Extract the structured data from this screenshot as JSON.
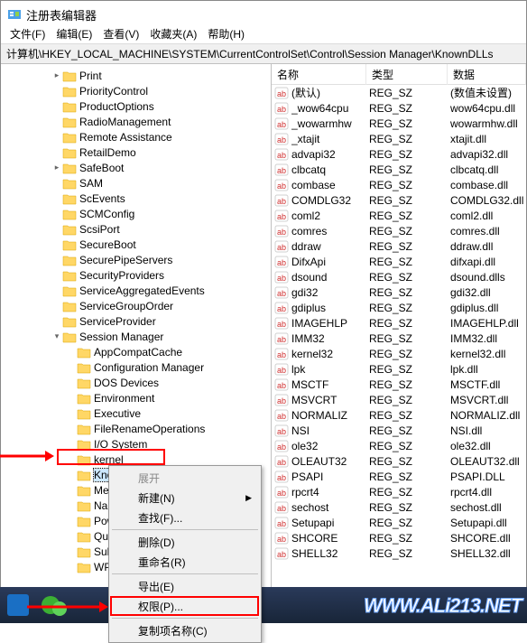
{
  "window": {
    "title": "注册表编辑器"
  },
  "menu": {
    "file": "文件(F)",
    "edit": "编辑(E)",
    "view": "查看(V)",
    "favorites": "收藏夹(A)",
    "help": "帮助(H)"
  },
  "address": {
    "path": "计算机\\HKEY_LOCAL_MACHINE\\SYSTEM\\CurrentControlSet\\Control\\Session Manager\\KnownDLLs"
  },
  "list_headers": {
    "name": "名称",
    "type": "类型",
    "data": "数据"
  },
  "tree": [
    {
      "indent": 3,
      "exp": ">",
      "label": "Print"
    },
    {
      "indent": 3,
      "exp": "",
      "label": "PriorityControl"
    },
    {
      "indent": 3,
      "exp": "",
      "label": "ProductOptions"
    },
    {
      "indent": 3,
      "exp": "",
      "label": "RadioManagement"
    },
    {
      "indent": 3,
      "exp": "",
      "label": "Remote Assistance"
    },
    {
      "indent": 3,
      "exp": "",
      "label": "RetailDemo"
    },
    {
      "indent": 3,
      "exp": ">",
      "label": "SafeBoot"
    },
    {
      "indent": 3,
      "exp": "",
      "label": "SAM"
    },
    {
      "indent": 3,
      "exp": "",
      "label": "ScEvents"
    },
    {
      "indent": 3,
      "exp": "",
      "label": "SCMConfig"
    },
    {
      "indent": 3,
      "exp": "",
      "label": "ScsiPort"
    },
    {
      "indent": 3,
      "exp": "",
      "label": "SecureBoot"
    },
    {
      "indent": 3,
      "exp": "",
      "label": "SecurePipeServers"
    },
    {
      "indent": 3,
      "exp": "",
      "label": "SecurityProviders"
    },
    {
      "indent": 3,
      "exp": "",
      "label": "ServiceAggregatedEvents"
    },
    {
      "indent": 3,
      "exp": "",
      "label": "ServiceGroupOrder"
    },
    {
      "indent": 3,
      "exp": "",
      "label": "ServiceProvider"
    },
    {
      "indent": 3,
      "exp": "v",
      "label": "Session Manager"
    },
    {
      "indent": 4,
      "exp": "",
      "label": "AppCompatCache"
    },
    {
      "indent": 4,
      "exp": "",
      "label": "Configuration Manager"
    },
    {
      "indent": 4,
      "exp": "",
      "label": "DOS Devices"
    },
    {
      "indent": 4,
      "exp": "",
      "label": "Environment"
    },
    {
      "indent": 4,
      "exp": "",
      "label": "Executive"
    },
    {
      "indent": 4,
      "exp": "",
      "label": "FileRenameOperations"
    },
    {
      "indent": 4,
      "exp": "",
      "label": "I/O System"
    },
    {
      "indent": 4,
      "exp": "",
      "label": "kernel"
    },
    {
      "indent": 4,
      "exp": "",
      "label": "KnownDLLs",
      "hl": true
    },
    {
      "indent": 4,
      "exp": "",
      "label": "Mem"
    },
    {
      "indent": 4,
      "exp": "",
      "label": "Nam"
    },
    {
      "indent": 4,
      "exp": "",
      "label": "Pow"
    },
    {
      "indent": 4,
      "exp": "",
      "label": "Quot"
    },
    {
      "indent": 4,
      "exp": "",
      "label": "SubS"
    },
    {
      "indent": 4,
      "exp": "",
      "label": "WPA"
    }
  ],
  "values": [
    {
      "name": "(默认)",
      "type": "REG_SZ",
      "data": "(数值未设置)"
    },
    {
      "name": "_wow64cpu",
      "type": "REG_SZ",
      "data": "wow64cpu.dll"
    },
    {
      "name": "_wowarmhw",
      "type": "REG_SZ",
      "data": "wowarmhw.dll"
    },
    {
      "name": "_xtajit",
      "type": "REG_SZ",
      "data": "xtajit.dll"
    },
    {
      "name": "advapi32",
      "type": "REG_SZ",
      "data": "advapi32.dll"
    },
    {
      "name": "clbcatq",
      "type": "REG_SZ",
      "data": "clbcatq.dll"
    },
    {
      "name": "combase",
      "type": "REG_SZ",
      "data": "combase.dll"
    },
    {
      "name": "COMDLG32",
      "type": "REG_SZ",
      "data": "COMDLG32.dll"
    },
    {
      "name": "coml2",
      "type": "REG_SZ",
      "data": "coml2.dll"
    },
    {
      "name": "comres",
      "type": "REG_SZ",
      "data": "comres.dll"
    },
    {
      "name": "ddraw",
      "type": "REG_SZ",
      "data": "ddraw.dll"
    },
    {
      "name": "DifxApi",
      "type": "REG_SZ",
      "data": "difxapi.dll"
    },
    {
      "name": "dsound",
      "type": "REG_SZ",
      "data": "dsound.dlls"
    },
    {
      "name": "gdi32",
      "type": "REG_SZ",
      "data": "gdi32.dll"
    },
    {
      "name": "gdiplus",
      "type": "REG_SZ",
      "data": "gdiplus.dll"
    },
    {
      "name": "IMAGEHLP",
      "type": "REG_SZ",
      "data": "IMAGEHLP.dll"
    },
    {
      "name": "IMM32",
      "type": "REG_SZ",
      "data": "IMM32.dll"
    },
    {
      "name": "kernel32",
      "type": "REG_SZ",
      "data": "kernel32.dll"
    },
    {
      "name": "lpk",
      "type": "REG_SZ",
      "data": "lpk.dll"
    },
    {
      "name": "MSCTF",
      "type": "REG_SZ",
      "data": "MSCTF.dll"
    },
    {
      "name": "MSVCRT",
      "type": "REG_SZ",
      "data": "MSVCRT.dll"
    },
    {
      "name": "NORMALIZ",
      "type": "REG_SZ",
      "data": "NORMALIZ.dll"
    },
    {
      "name": "NSI",
      "type": "REG_SZ",
      "data": "NSI.dll"
    },
    {
      "name": "ole32",
      "type": "REG_SZ",
      "data": "ole32.dll"
    },
    {
      "name": "OLEAUT32",
      "type": "REG_SZ",
      "data": "OLEAUT32.dll"
    },
    {
      "name": "PSAPI",
      "type": "REG_SZ",
      "data": "PSAPI.DLL"
    },
    {
      "name": "rpcrt4",
      "type": "REG_SZ",
      "data": "rpcrt4.dll"
    },
    {
      "name": "sechost",
      "type": "REG_SZ",
      "data": "sechost.dll"
    },
    {
      "name": "Setupapi",
      "type": "REG_SZ",
      "data": "Setupapi.dll"
    },
    {
      "name": "SHCORE",
      "type": "REG_SZ",
      "data": "SHCORE.dll"
    },
    {
      "name": "SHELL32",
      "type": "REG_SZ",
      "data": "SHELL32.dll"
    }
  ],
  "context_menu": {
    "expand": "展开",
    "new": "新建(N)",
    "find": "查找(F)...",
    "delete": "删除(D)",
    "rename": "重命名(R)",
    "export": "导出(E)",
    "permissions": "权限(P)...",
    "copy_key_name": "复制项名称(C)"
  },
  "watermark": "WWW.ALi213.NET"
}
